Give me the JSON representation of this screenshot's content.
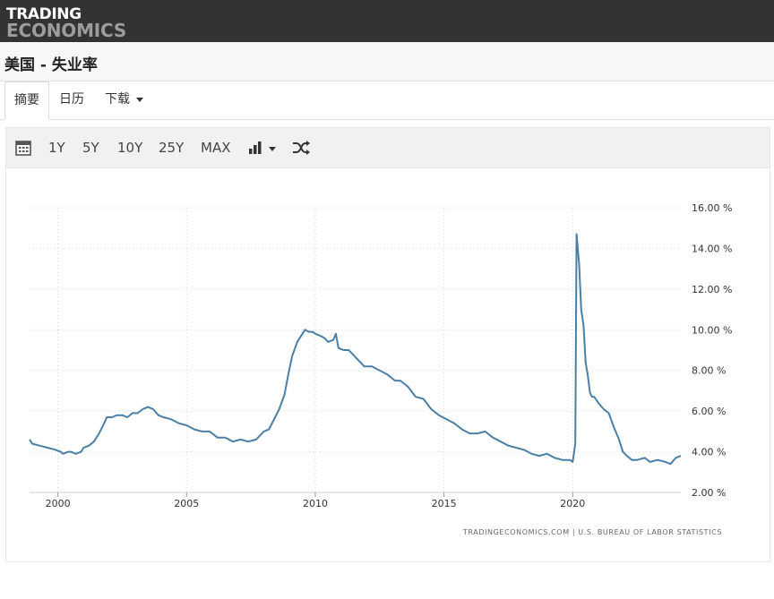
{
  "header": {
    "logo_line1": "TRADING",
    "logo_line2": "ECONOMICS"
  },
  "page": {
    "title": "美国 - 失业率"
  },
  "tabs": [
    {
      "label": "摘要",
      "active": true
    },
    {
      "label": "日历",
      "active": false
    },
    {
      "label": "下载",
      "active": false,
      "dropdown": true
    }
  ],
  "toolbar": {
    "calendar_icon": "calendar-icon",
    "ranges": [
      "1Y",
      "5Y",
      "10Y",
      "25Y",
      "MAX"
    ],
    "chart_type_icon": "bar-chart-icon",
    "shuffle_icon": "shuffle-icon"
  },
  "chart_data": {
    "type": "line",
    "title": "",
    "xlabel": "",
    "ylabel": "",
    "x_ticks": [
      "2000",
      "2005",
      "2010",
      "2015",
      "2020"
    ],
    "y_ticks": [
      "16.00 %",
      "14.00 %",
      "12.00 %",
      "10.00 %",
      "8.00 %",
      "6.00 %",
      "4.00 %",
      "2.00 %"
    ],
    "xlim": [
      1998.9,
      2024.2
    ],
    "ylim": [
      2,
      16
    ],
    "grid": true,
    "color": "#4a7fa6",
    "source": "TRADINGECONOMICS.COM  |  U.S. BUREAU OF LABOR STATISTICS",
    "series": [
      {
        "x": [
          1998.9,
          1999.0,
          1999.3,
          1999.6,
          1999.9,
          2000.1,
          2000.2,
          2000.4,
          2000.5,
          2000.7,
          2000.9,
          2001.0,
          2001.2,
          2001.4,
          2001.6,
          2001.8,
          2001.9,
          2002.1,
          2002.3,
          2002.5,
          2002.7,
          2002.9,
          2003.1,
          2003.3,
          2003.5,
          2003.7,
          2003.9,
          2004.1,
          2004.4,
          2004.7,
          2005.0,
          2005.3,
          2005.6,
          2005.9,
          2006.2,
          2006.5,
          2006.8,
          2007.1,
          2007.4,
          2007.7,
          2008.0,
          2008.2,
          2008.4,
          2008.6,
          2008.8,
          2008.95,
          2009.1,
          2009.3,
          2009.5,
          2009.6,
          2009.75,
          2009.9,
          2010.0,
          2010.2,
          2010.35,
          2010.5,
          2010.7,
          2010.8,
          2010.9,
          2011.1,
          2011.3,
          2011.6,
          2011.9,
          2012.2,
          2012.5,
          2012.8,
          2013.1,
          2013.3,
          2013.6,
          2013.9,
          2014.2,
          2014.5,
          2014.8,
          2015.1,
          2015.4,
          2015.7,
          2016.0,
          2016.3,
          2016.6,
          2016.9,
          2017.2,
          2017.5,
          2017.8,
          2018.1,
          2018.4,
          2018.7,
          2019.0,
          2019.3,
          2019.6,
          2019.9,
          2020.0,
          2020.1,
          2020.15,
          2020.25,
          2020.33,
          2020.42,
          2020.5,
          2020.58,
          2020.67,
          2020.75,
          2020.83,
          2021.0,
          2021.2,
          2021.4,
          2021.6,
          2021.8,
          2021.95,
          2022.1,
          2022.3,
          2022.5,
          2022.8,
          2023.0,
          2023.3,
          2023.6,
          2023.8,
          2024.0,
          2024.2
        ],
        "y": [
          4.6,
          4.4,
          4.3,
          4.2,
          4.1,
          4.0,
          3.9,
          4.0,
          4.0,
          3.9,
          4.0,
          4.2,
          4.3,
          4.5,
          4.9,
          5.4,
          5.7,
          5.7,
          5.8,
          5.8,
          5.7,
          5.9,
          5.9,
          6.1,
          6.2,
          6.1,
          5.8,
          5.7,
          5.6,
          5.4,
          5.3,
          5.1,
          5.0,
          5.0,
          4.7,
          4.7,
          4.5,
          4.6,
          4.5,
          4.6,
          5.0,
          5.1,
          5.6,
          6.1,
          6.8,
          7.8,
          8.7,
          9.4,
          9.8,
          10.0,
          9.9,
          9.9,
          9.8,
          9.7,
          9.6,
          9.4,
          9.5,
          9.8,
          9.1,
          9.0,
          9.0,
          8.6,
          8.2,
          8.2,
          8.0,
          7.8,
          7.5,
          7.5,
          7.2,
          6.7,
          6.6,
          6.1,
          5.8,
          5.6,
          5.4,
          5.1,
          4.9,
          4.9,
          5.0,
          4.7,
          4.5,
          4.3,
          4.2,
          4.1,
          3.9,
          3.8,
          3.9,
          3.7,
          3.6,
          3.6,
          3.5,
          4.4,
          14.7,
          13.2,
          11.0,
          10.2,
          8.4,
          7.8,
          6.9,
          6.7,
          6.7,
          6.4,
          6.1,
          5.9,
          5.2,
          4.6,
          4.0,
          3.8,
          3.6,
          3.6,
          3.7,
          3.5,
          3.6,
          3.5,
          3.4,
          3.7,
          3.8
        ]
      }
    ]
  }
}
